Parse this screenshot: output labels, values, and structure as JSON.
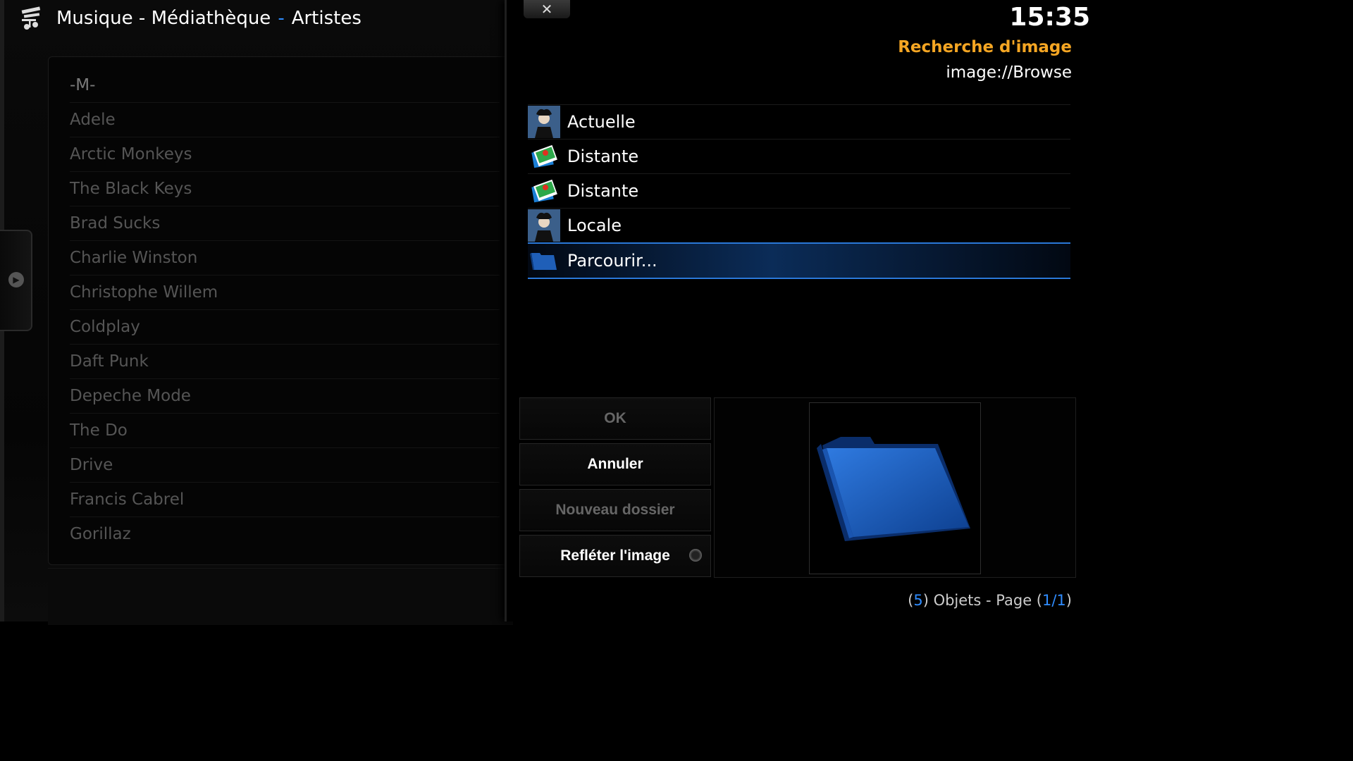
{
  "header": {
    "section": "Musique - Médiathèque",
    "separator": "-",
    "view": "Artistes",
    "logo_icon": "music-library-icon"
  },
  "artists": [
    "-M-",
    "Adele",
    "Arctic Monkeys",
    "The Black Keys",
    "Brad Sucks",
    "Charlie Winston",
    "Christophe Willem",
    "Coldplay",
    "Daft Punk",
    "Depeche Mode",
    "The Do",
    "Drive",
    "Francis Cabrel",
    "Gorillaz"
  ],
  "dialog": {
    "close_icon": "close-icon",
    "clock": "15:35",
    "title": "Recherche d'image",
    "path": "image://Browse",
    "items": [
      {
        "label": "Actuelle",
        "icon": "artist-thumb-icon"
      },
      {
        "label": "Distante",
        "icon": "pictures-icon"
      },
      {
        "label": "Distante",
        "icon": "pictures-icon"
      },
      {
        "label": "Locale",
        "icon": "artist-thumb-icon"
      },
      {
        "label": "Parcourir...",
        "icon": "folder-icon",
        "focused": true
      }
    ],
    "buttons": {
      "ok": "OK",
      "cancel": "Annuler",
      "new_folder": "Nouveau dossier",
      "flip": "Refléter l'image"
    },
    "footer": {
      "open1": "(",
      "count": "5",
      "mid": ") Objets - Page (",
      "page": "1/1",
      "close": ")"
    }
  },
  "colors": {
    "accent": "#2f8cff",
    "title": "#f5a623"
  }
}
